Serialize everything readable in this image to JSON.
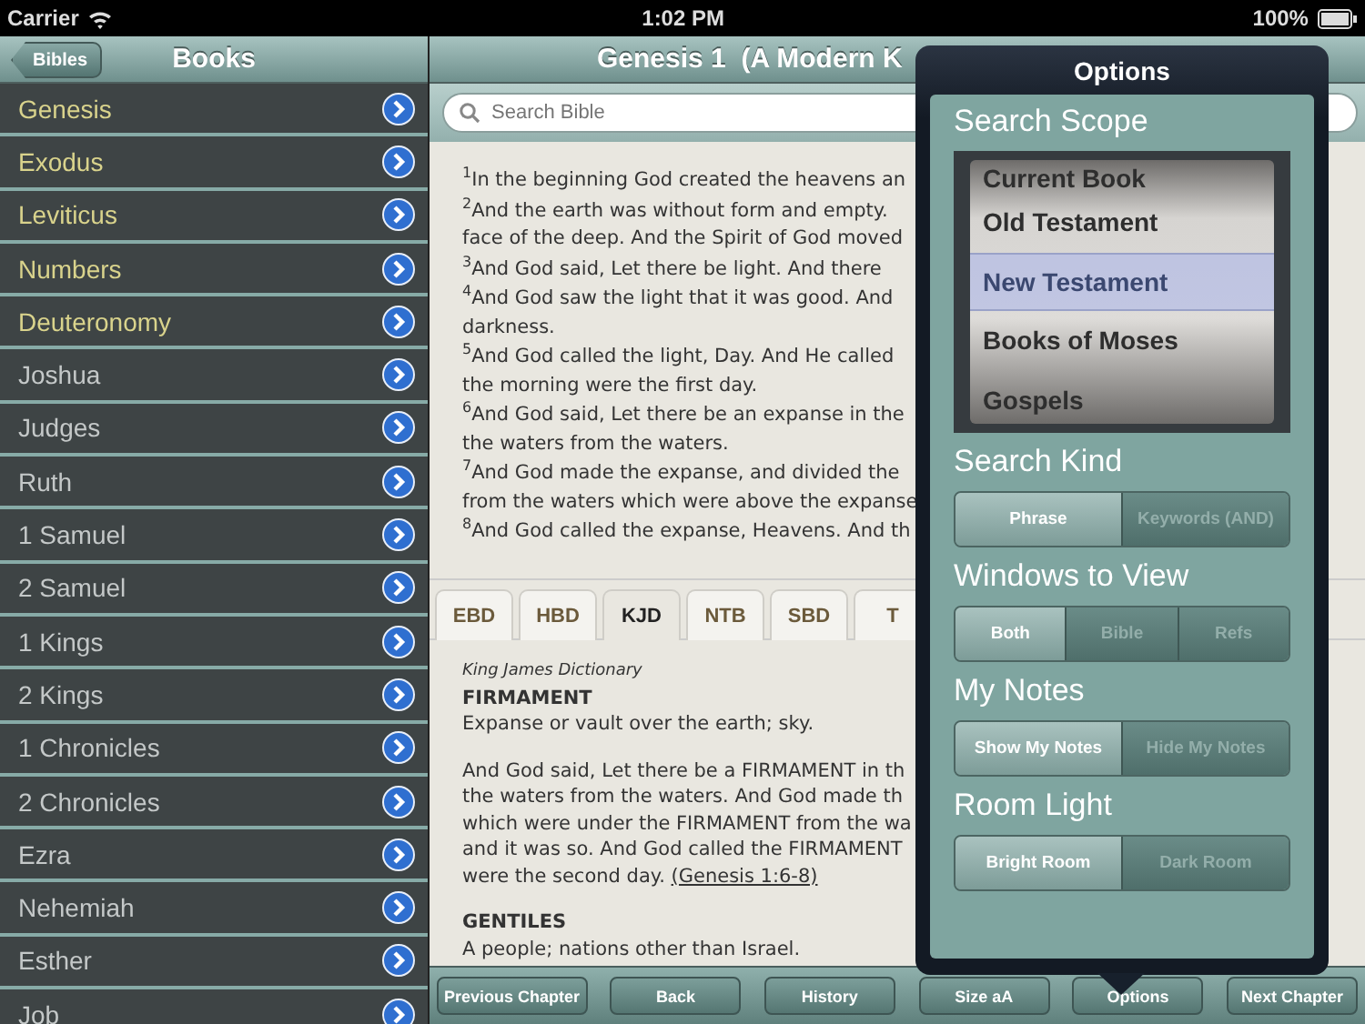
{
  "status_bar": {
    "carrier": "Carrier",
    "time": "1:02 PM",
    "battery": "100%"
  },
  "sidebar": {
    "back_button": "Bibles",
    "title": "Books",
    "items": [
      {
        "label": "Genesis",
        "color": "#d9d38c"
      },
      {
        "label": "Exodus",
        "color": "#d9d38c"
      },
      {
        "label": "Leviticus",
        "color": "#d9d38c"
      },
      {
        "label": "Numbers",
        "color": "#d9d38c"
      },
      {
        "label": "Deuteronomy",
        "color": "#d9d38c"
      },
      {
        "label": "Joshua",
        "color": "#c4c8c8"
      },
      {
        "label": "Judges",
        "color": "#c4c8c8"
      },
      {
        "label": "Ruth",
        "color": "#c4c8c8"
      },
      {
        "label": "1 Samuel",
        "color": "#c4c8c8"
      },
      {
        "label": "2 Samuel",
        "color": "#c4c8c8"
      },
      {
        "label": "1 Kings",
        "color": "#c4c8c8"
      },
      {
        "label": "2 Kings",
        "color": "#c4c8c8"
      },
      {
        "label": "1 Chronicles",
        "color": "#c4c8c8"
      },
      {
        "label": "2 Chronicles",
        "color": "#c4c8c8"
      },
      {
        "label": "Ezra",
        "color": "#c4c8c8"
      },
      {
        "label": "Nehemiah",
        "color": "#c4c8c8"
      },
      {
        "label": "Esther",
        "color": "#c4c8c8"
      },
      {
        "label": "Job",
        "color": "#c4c8c8"
      }
    ]
  },
  "main": {
    "title": "Genesis 1  (A Modern K",
    "search": {
      "placeholder": "Search Bible"
    },
    "verses": [
      {
        "number": "1",
        "lines": [
          "In the beginning God created the heavens an"
        ]
      },
      {
        "number": "2",
        "lines": [
          "And the earth was without form and empty.",
          "face of the deep. And the Spirit of God moved"
        ]
      },
      {
        "number": "3",
        "lines": [
          "And God said, Let there be light. And there"
        ]
      },
      {
        "number": "4",
        "lines": [
          "And God saw the light that it was good. And",
          "darkness."
        ]
      },
      {
        "number": "5",
        "lines": [
          "And God called the light, Day. And He called",
          "the morning were the first day."
        ]
      },
      {
        "number": "6",
        "lines": [
          "And God said, Let there be an expanse in the",
          "the waters from the waters."
        ]
      },
      {
        "number": "7",
        "lines": [
          "And God made the expanse, and divided the",
          "from the waters which were above the expanse"
        ]
      },
      {
        "number": "8",
        "lines": [
          "And God called the expanse, Heavens. And th"
        ]
      }
    ],
    "tabs": [
      {
        "label": "EBD",
        "selected": false
      },
      {
        "label": "HBD",
        "selected": false
      },
      {
        "label": "KJD",
        "selected": true
      },
      {
        "label": "NTB",
        "selected": false
      },
      {
        "label": "SBD",
        "selected": false
      },
      {
        "label": "T",
        "selected": false
      }
    ],
    "dictionary": {
      "source": "King James Dictionary",
      "entries": [
        {
          "term": "FIRMAMENT",
          "definition": "Expanse or vault over the earth; sky.",
          "example_lines": [
            "And God said, Let there be a FIRMAMENT in th",
            "the waters from the waters. And God made th",
            "which were under the FIRMAMENT from the wa",
            "and it was so. And God called the FIRMAMENT",
            "were the second day. "
          ],
          "reference": "(Genesis 1:6-8)"
        },
        {
          "term": "GENTILES",
          "definition": "A people; nations other than Israel."
        }
      ]
    },
    "toolbar": [
      "Previous Chapter",
      "Back",
      "History",
      "Size aA",
      "Options",
      "Next Chapter"
    ]
  },
  "options_popover": {
    "title": "Options",
    "search_scope": {
      "label": "Search Scope",
      "options": [
        {
          "label": "Current Book",
          "selected": false
        },
        {
          "label": "Old Testament",
          "selected": false
        },
        {
          "label": "New Testament",
          "selected": true
        },
        {
          "label": "Books of Moses",
          "selected": false
        },
        {
          "label": "Gospels",
          "selected": false
        }
      ]
    },
    "segments": [
      {
        "label": "Search Kind",
        "options": [
          {
            "label": "Phrase",
            "selected": true
          },
          {
            "label": "Keywords (AND)",
            "selected": false
          }
        ]
      },
      {
        "label": "Windows to View",
        "options": [
          {
            "label": "Both",
            "selected": true
          },
          {
            "label": "Bible",
            "selected": false
          },
          {
            "label": "Refs",
            "selected": false
          }
        ]
      },
      {
        "label": "My Notes",
        "options": [
          {
            "label": "Show My Notes",
            "selected": true
          },
          {
            "label": "Hide My Notes",
            "selected": false
          }
        ]
      },
      {
        "label": "Room Light",
        "options": [
          {
            "label": "Bright Room",
            "selected": true
          },
          {
            "label": "Dark Room",
            "selected": false
          }
        ]
      }
    ]
  }
}
